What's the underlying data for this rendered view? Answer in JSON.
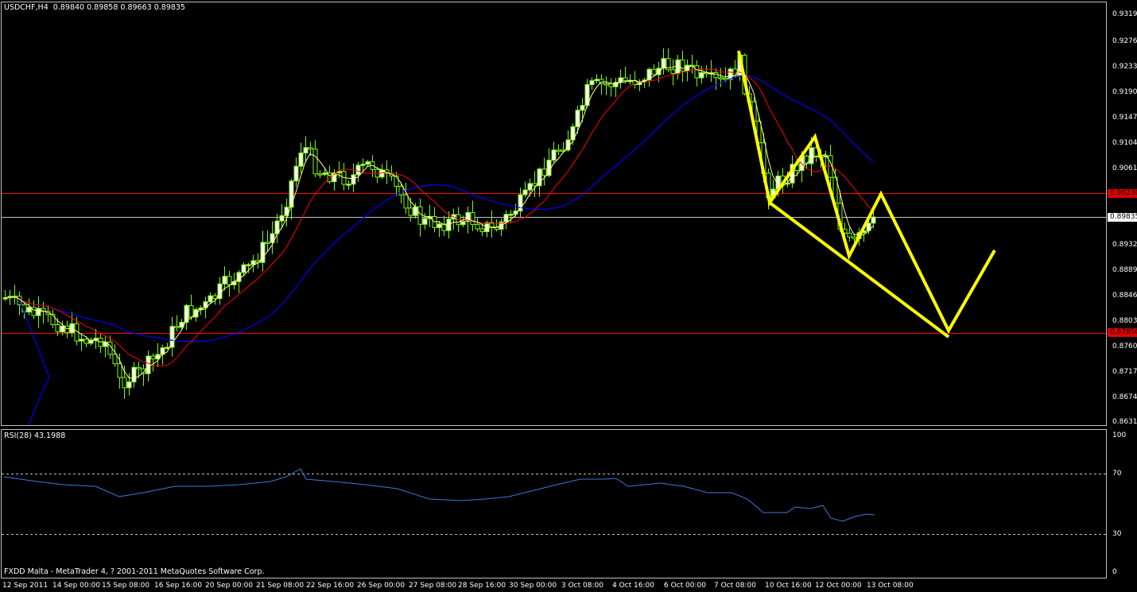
{
  "main_chart": {
    "title": "USDCHF,H4",
    "ohlc_text": "0.89840 0.89858 0.89663 0.89835",
    "y_axis_labels": [
      "0.93190",
      "0.92760",
      "0.92330",
      "0.91900",
      "0.91470",
      "0.91040",
      "0.90610",
      "0.90180",
      "0.89750",
      "0.89320",
      "0.88890",
      "0.88460",
      "0.88030",
      "0.87600",
      "0.87170",
      "0.86740",
      "0.86310"
    ],
    "current_price_tag": "0.89835",
    "upper_line_tag": "0.90230",
    "lower_line_tag": "0.87850",
    "colors": {
      "background": "#000000",
      "grid_frame": "#c0c0c0",
      "bull_body": "#ffffff",
      "bear_body": "#000000",
      "candle_wick": "#7cfc00",
      "ma_fast": "#ffff99",
      "ma_mid": "#ff0000",
      "ma_slow": "#0000ff",
      "hline": "#ff0000",
      "price_line": "#c0c0c0",
      "drawing": "#ffff00"
    }
  },
  "rsi_panel": {
    "title": "RSI(28) 43.1988",
    "y_axis_labels": [
      "100",
      "70",
      "30",
      "0"
    ],
    "color": "#3a7bd5"
  },
  "x_axis_labels": [
    "12 Sep 2011",
    "14 Sep 00:00",
    "15 Sep 08:00",
    "16 Sep 16:00",
    "20 Sep 00:00",
    "21 Sep 08:00",
    "22 Sep 16:00",
    "26 Sep 00:00",
    "27 Sep 08:00",
    "28 Sep 16:00",
    "30 Sep 00:00",
    "3 Oct 08:00",
    "4 Oct 16:00",
    "6 Oct 00:00",
    "7 Oct 08:00",
    "10 Oct 16:00",
    "12 Oct 00:00",
    "13 Oct 08:00"
  ],
  "footer": {
    "copyright": "FXDD Malta - MetaTrader 4, ? 2001-2011 MetaQuotes Software Corp."
  }
}
